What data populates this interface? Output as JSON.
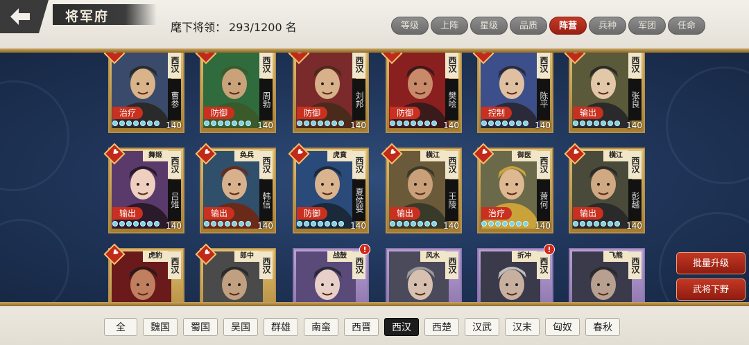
{
  "header": {
    "title": "将军府",
    "count_label": "麾下将领：",
    "count_value": "293/1200 名",
    "filters": [
      "等级",
      "上阵",
      "星级",
      "品质",
      "阵营",
      "兵种",
      "军团",
      "任命"
    ],
    "active_filter": "阵营"
  },
  "cards": [
    {
      "faction": "西汉",
      "name": "曹参",
      "title": "",
      "role": "治疗",
      "level": "140",
      "stars": 7,
      "quality": "gold",
      "alert": false
    },
    {
      "faction": "西汉",
      "name": "周勃",
      "title": "",
      "role": "防御",
      "level": "140",
      "stars": 7,
      "quality": "gold",
      "alert": false
    },
    {
      "faction": "西汉",
      "name": "刘邦",
      "title": "",
      "role": "防御",
      "level": "140",
      "stars": 7,
      "quality": "gold",
      "alert": false
    },
    {
      "faction": "西汉",
      "name": "樊哙",
      "title": "",
      "role": "防御",
      "level": "140",
      "stars": 7,
      "quality": "gold",
      "alert": false
    },
    {
      "faction": "西汉",
      "name": "陈平",
      "title": "",
      "role": "控制",
      "level": "140",
      "stars": 7,
      "quality": "gold",
      "alert": false
    },
    {
      "faction": "西汉",
      "name": "张良",
      "title": "",
      "role": "输出",
      "level": "140",
      "stars": 7,
      "quality": "gold",
      "alert": false
    },
    {
      "faction": "西汉",
      "name": "吕雉",
      "title": "舞姬",
      "role": "输出",
      "level": "140",
      "stars": 7,
      "quality": "gold",
      "alert": false
    },
    {
      "faction": "西汉",
      "name": "韩信",
      "title": "奂兵",
      "role": "输出",
      "level": "140",
      "stars": 7,
      "quality": "gold",
      "alert": false
    },
    {
      "faction": "西汉",
      "name": "夏侯婴",
      "title": "虎賁",
      "role": "防御",
      "level": "140",
      "stars": 7,
      "quality": "gold",
      "alert": false
    },
    {
      "faction": "西汉",
      "name": "王陵",
      "title": "横江",
      "role": "输出",
      "level": "140",
      "stars": 7,
      "quality": "gold",
      "alert": false
    },
    {
      "faction": "西汉",
      "name": "萧何",
      "title": "御医",
      "role": "治疗",
      "level": "140",
      "stars": 7,
      "quality": "gold",
      "alert": false
    },
    {
      "faction": "西汉",
      "name": "彭越",
      "title": "横江",
      "role": "输出",
      "level": "140",
      "stars": 7,
      "quality": "gold",
      "alert": false
    },
    {
      "faction": "西汉",
      "name": "",
      "title": "虎豹",
      "role": "",
      "level": "",
      "stars": 0,
      "quality": "gold",
      "alert": false
    },
    {
      "faction": "西汉",
      "name": "",
      "title": "郎中",
      "role": "",
      "level": "",
      "stars": 0,
      "quality": "gold",
      "alert": false
    },
    {
      "faction": "西汉",
      "name": "",
      "title": "战鼓",
      "role": "",
      "level": "",
      "stars": 0,
      "quality": "purple",
      "alert": true
    },
    {
      "faction": "西汉",
      "name": "",
      "title": "风水",
      "role": "",
      "level": "",
      "stars": 0,
      "quality": "purple",
      "alert": false
    },
    {
      "faction": "西汉",
      "name": "",
      "title": "折冲",
      "role": "",
      "level": "",
      "stars": 0,
      "quality": "purple",
      "alert": true
    },
    {
      "faction": "西汉",
      "name": "",
      "title": "飞熊",
      "role": "",
      "level": "",
      "stars": 0,
      "quality": "purple",
      "alert": false
    }
  ],
  "side_buttons": {
    "batch_upgrade": "批量升级",
    "dismiss": "武将下野"
  },
  "kingdom_tabs": [
    "全",
    "魏国",
    "蜀国",
    "吴国",
    "群雄",
    "南蛮",
    "西晋",
    "西汉",
    "西楚",
    "汉武",
    "汉末",
    "匈奴",
    "春秋"
  ],
  "active_kingdom": "西汉",
  "colors": {
    "panel_bg": "#1f3458",
    "accent_red": "#c43a26",
    "gold": "#c9a45e",
    "star": "#7bd3e8"
  }
}
